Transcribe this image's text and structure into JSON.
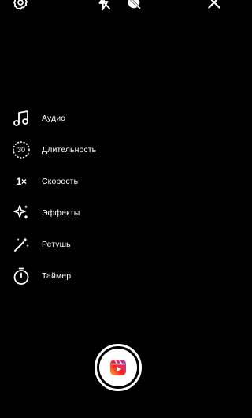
{
  "top_bar": {
    "icons": [
      "settings-icon",
      "flash-off-icon",
      "filter-off-icon",
      "close-icon"
    ]
  },
  "tools": [
    {
      "icon": "music-note-icon",
      "label": "Аудио"
    },
    {
      "icon": "duration-icon",
      "icon_text": "30",
      "label": "Длительность"
    },
    {
      "icon": "speed-icon",
      "icon_text": "1×",
      "label": "Скорость"
    },
    {
      "icon": "sparkles-icon",
      "label": "Эффекты"
    },
    {
      "icon": "magic-wand-icon",
      "label": "Ретушь"
    },
    {
      "icon": "timer-icon",
      "label": "Таймер"
    }
  ],
  "shutter": {
    "icon": "reels-icon",
    "gradient": [
      "#833ab4",
      "#e1306c",
      "#fd1d1d",
      "#fcb045"
    ]
  },
  "colors": {
    "background": "#000000",
    "foreground": "#ffffff"
  }
}
